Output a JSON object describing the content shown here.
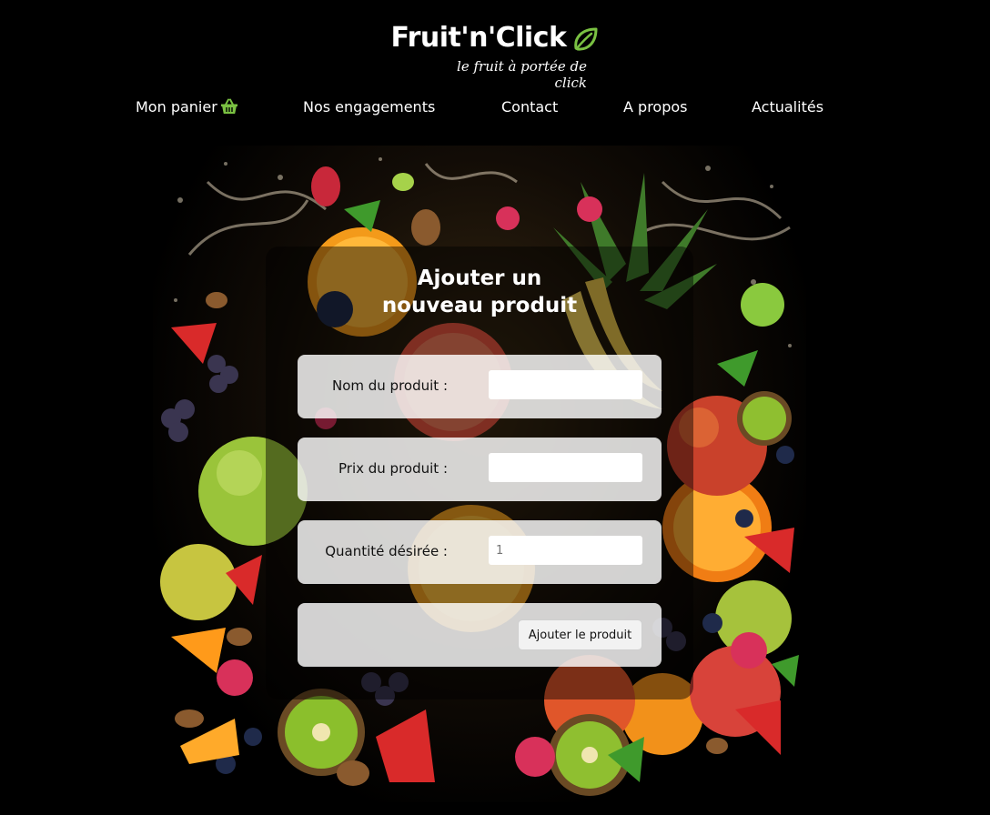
{
  "brand": {
    "title": "Fruit'n'Click",
    "tagline": "le fruit à portée de click",
    "accent_color": "#7ac142",
    "logo_icon": "leaf-icon"
  },
  "nav": {
    "items": [
      {
        "label": "Mon panier",
        "icon": "basket-icon"
      },
      {
        "label": "Nos engagements"
      },
      {
        "label": "Contact"
      },
      {
        "label": "A propos"
      },
      {
        "label": "Actualités"
      }
    ]
  },
  "form": {
    "title_line1": "Ajouter un",
    "title_line2": "nouveau produit",
    "fields": [
      {
        "label": "Nom du produit :",
        "value": "",
        "placeholder": ""
      },
      {
        "label": "Prix du produit :",
        "value": "",
        "placeholder": ""
      },
      {
        "label": "Quantité désirée :",
        "value": "",
        "placeholder": "1"
      }
    ],
    "submit_label": "Ajouter le produit"
  }
}
